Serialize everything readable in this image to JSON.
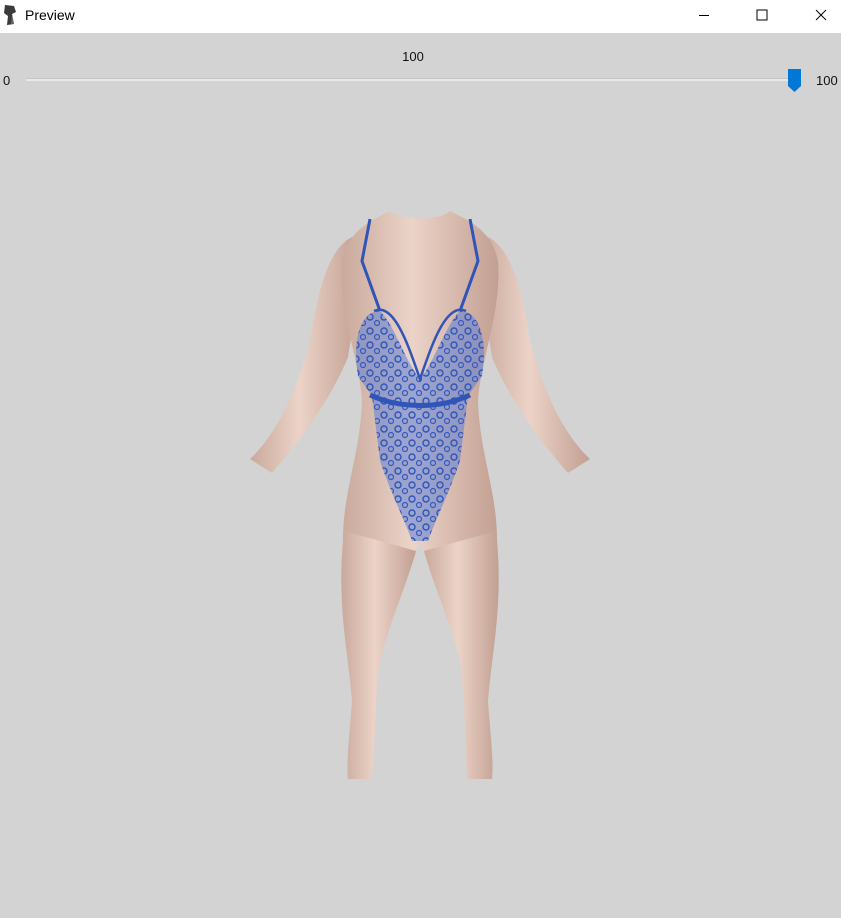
{
  "window": {
    "title": "Preview",
    "icons": {
      "app": "app-icon",
      "minimize": "minimize-icon",
      "maximize": "maximize-icon",
      "close": "close-icon"
    }
  },
  "slider": {
    "value_label": "100",
    "min_label": "0",
    "max_label": "100",
    "value": 100,
    "accent_color": "#0078d7"
  },
  "preview": {
    "background_color": "#d3d3d3",
    "outfit_color": "#3d66c7"
  }
}
